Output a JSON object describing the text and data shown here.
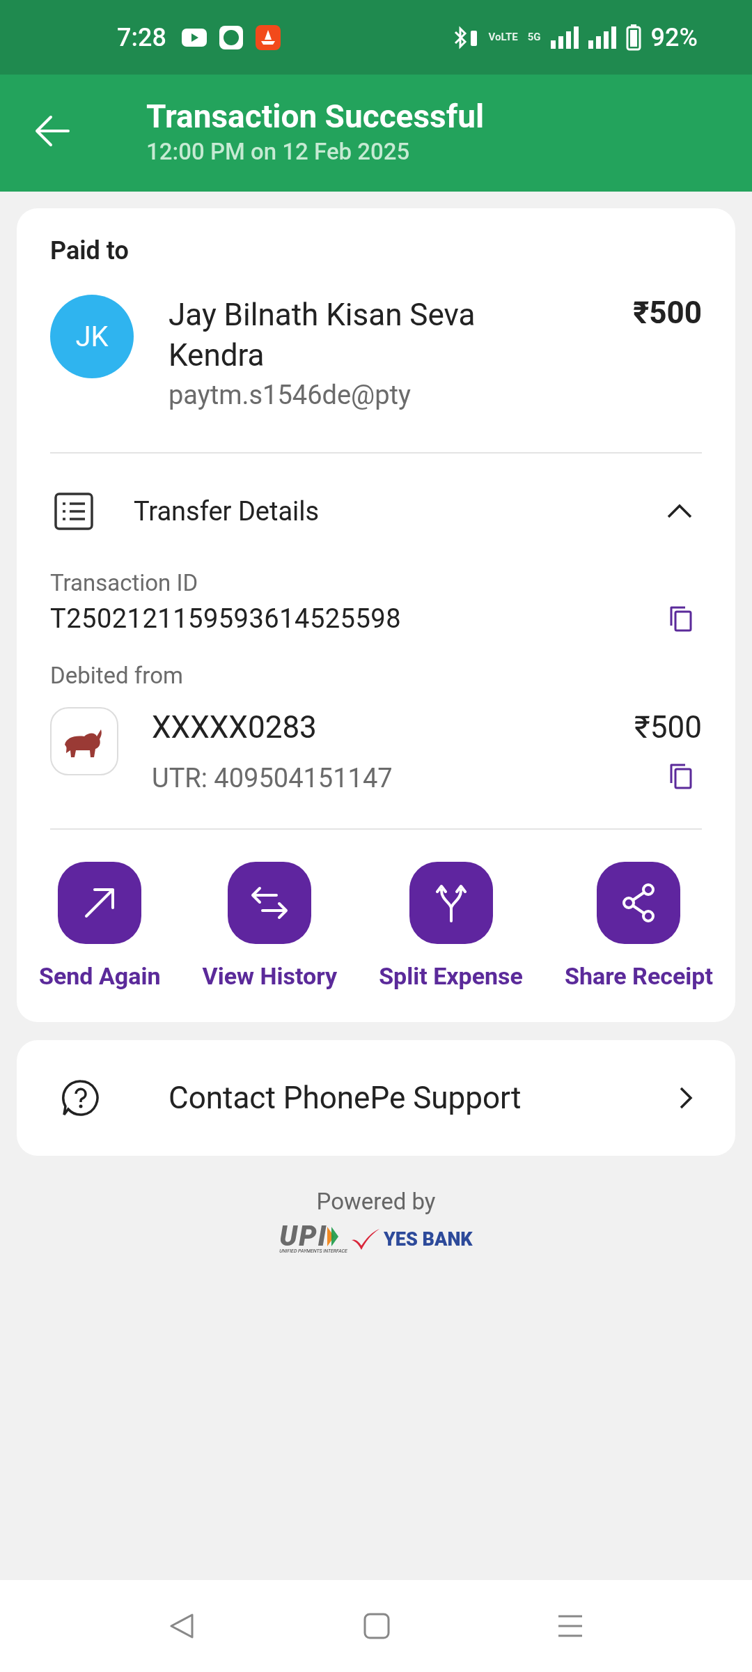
{
  "status_bar": {
    "time": "7:28",
    "battery": "92%",
    "network_1": "VoLTE",
    "network_2": "5G"
  },
  "header": {
    "title": "Transaction Successful",
    "subtitle": "12:00 PM on 12 Feb 2025"
  },
  "paid_to": {
    "label": "Paid to",
    "avatar": "JK",
    "name": "Jay Bilnath Kisan Seva Kendra",
    "upi_id": "paytm.s1546de@pty",
    "amount": "₹500"
  },
  "transfer_details": {
    "title": "Transfer Details",
    "expanded": true,
    "transaction_id_label": "Transaction ID",
    "transaction_id": "T2502121159593614525598",
    "debited_label": "Debited from",
    "account": "XXXXX0283",
    "amount": "₹500",
    "utr": "UTR: 409504151147"
  },
  "actions": [
    {
      "kind": "send",
      "label": "Send Again"
    },
    {
      "kind": "history",
      "label": "View History"
    },
    {
      "kind": "split",
      "label": "Split Expense"
    },
    {
      "kind": "share",
      "label": "Share Receipt"
    }
  ],
  "support": {
    "label": "Contact PhonePe Support"
  },
  "footer": {
    "powered_by": "Powered by",
    "upi_logo": "UPI",
    "upi_tagline": "UNIFIED PAYMENTS INTERFACE",
    "bank_logo": "YES BANK"
  }
}
